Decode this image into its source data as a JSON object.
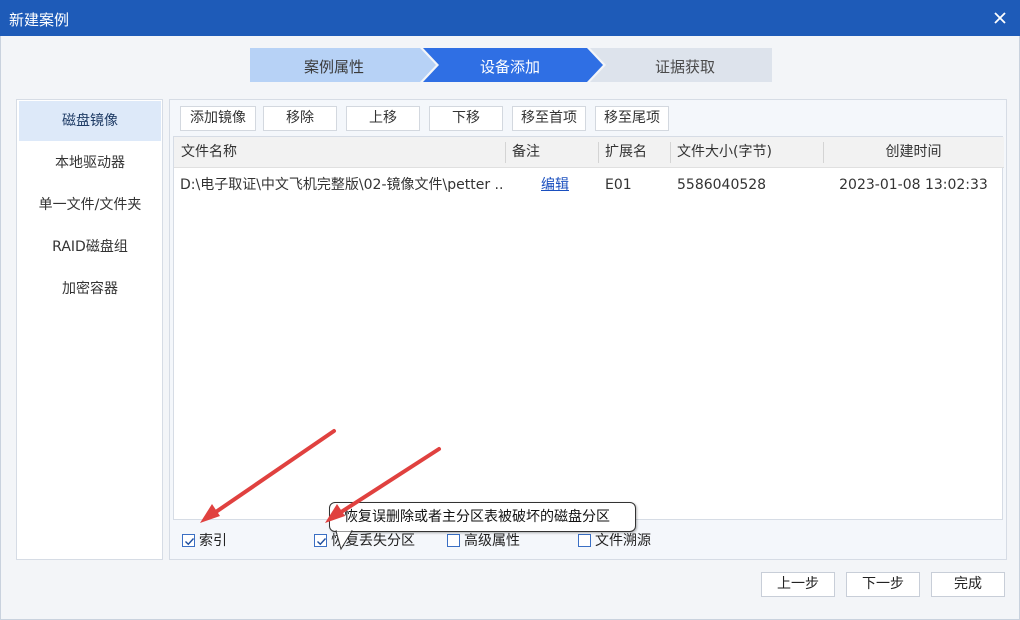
{
  "window": {
    "title": "新建案例"
  },
  "wizard": {
    "steps": [
      {
        "label": "案例属性"
      },
      {
        "label": "设备添加"
      },
      {
        "label": "证据获取"
      }
    ]
  },
  "sidebar": {
    "items": [
      {
        "label": "磁盘镜像"
      },
      {
        "label": "本地驱动器"
      },
      {
        "label": "单一文件/文件夹"
      },
      {
        "label": "RAID磁盘组"
      },
      {
        "label": "加密容器"
      }
    ]
  },
  "toolbar": {
    "add_image": "添加镜像",
    "remove": "移除",
    "move_up": "上移",
    "move_down": "下移",
    "move_first": "移至首项",
    "move_last": "移至尾项"
  },
  "table": {
    "columns": [
      "文件名称",
      "备注",
      "扩展名",
      "文件大小(字节)",
      "创建时间"
    ],
    "rows": [
      {
        "file_name": "D:\\电子取证\\中文飞机完整版\\02-镜像文件\\petter ...",
        "note": "编辑",
        "extension": "E01",
        "size": "5586040528",
        "created": "2023-01-08 13:02:33"
      }
    ]
  },
  "options": {
    "index": "索引",
    "recover": "恢复丢失分区",
    "advanced": "高级属性",
    "trace": "文件溯源"
  },
  "tooltip": {
    "text": "恢复误删除或者主分区表被破坏的磁盘分区"
  },
  "footer": {
    "prev": "上一步",
    "next": "下一步",
    "finish": "完成"
  },
  "colors": {
    "titlebar": "#1e5bb8",
    "active_step": "#2f6fe4",
    "done_step": "#b7d2f6",
    "pending_step": "#dde3ec",
    "annotation_arrow": "#e0413f"
  }
}
